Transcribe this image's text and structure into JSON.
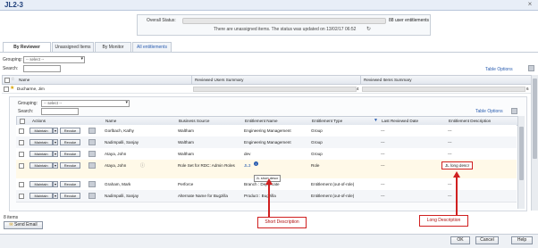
{
  "window": {
    "title": "JL2-3",
    "close": "×"
  },
  "status": {
    "label": "Overall Status:",
    "count_text": "88 user entitlements",
    "message": "There are unassigned items. The status was updated on 13/02/17 06:52",
    "refresh": "↻"
  },
  "tabs": [
    {
      "label": "By Reviewer"
    },
    {
      "label": "Unassigned Items"
    },
    {
      "label": "By Monitor"
    },
    {
      "label": "All entitlements"
    }
  ],
  "outer": {
    "grouping_label": "Grouping:",
    "grouping_value": "-- select --",
    "search_label": "Search:",
    "table_options": "Table Options",
    "columns": [
      "Name",
      "Reviewed Users Summary",
      "Reviewed Items Summary"
    ],
    "reviewer": {
      "name": "Ducharme, Jim",
      "users_count": "4",
      "items_count": "6"
    }
  },
  "inner": {
    "grouping_label": "Grouping:",
    "grouping_value": "-- select --",
    "search_label": "Search:",
    "table_options": "Table Options",
    "columns": [
      "Actions",
      "Name",
      "Business Source",
      "Entitlement Name",
      "Entitlement Type",
      "Last Reviewed Date",
      "Entitlement Description"
    ],
    "maintain_label": "Maintain",
    "revoke_label": "Revoke",
    "rows": [
      {
        "name": "Gorlbach, Kathy",
        "source": "Waltham",
        "ent": "Engineering Management",
        "type": "Group",
        "date": "---",
        "desc": "---"
      },
      {
        "name": "Nadimpalli, Sanjay",
        "source": "Waltham",
        "ent": "Engineering Management",
        "type": "Group",
        "date": "---",
        "desc": "---"
      },
      {
        "name": "Ataya, John",
        "source": "Waltham",
        "ent": "dev",
        "type": "Group",
        "date": "---",
        "desc": "---"
      },
      {
        "name": "Ataya, John",
        "source": "Role Set for RDC: Admin Roles",
        "ent": "JL3",
        "type": "Role",
        "date": "---",
        "desc": "JL long descr"
      },
      {
        "name": "Graham, Mark",
        "source": "Perforce",
        "ent": "Branch : Deprecate",
        "type": "Entitlement (out-of-role)",
        "date": "---",
        "desc": "---"
      },
      {
        "name": "Nadimpalli, Sanjay",
        "source": "Alternate Name for Bugzilla",
        "ent": "Product : Bugzilla",
        "type": "Entitlement (out-of-role)",
        "date": "---",
        "desc": "---"
      }
    ],
    "tooltip": "JL short descr"
  },
  "footer": {
    "items_count": "8 items",
    "send_email": "Send Email",
    "ok": "OK",
    "cancel": "Cancel",
    "help": "Help"
  },
  "annotations": {
    "short": "Short Description",
    "long": "Long Description",
    "color": "#d02020"
  }
}
